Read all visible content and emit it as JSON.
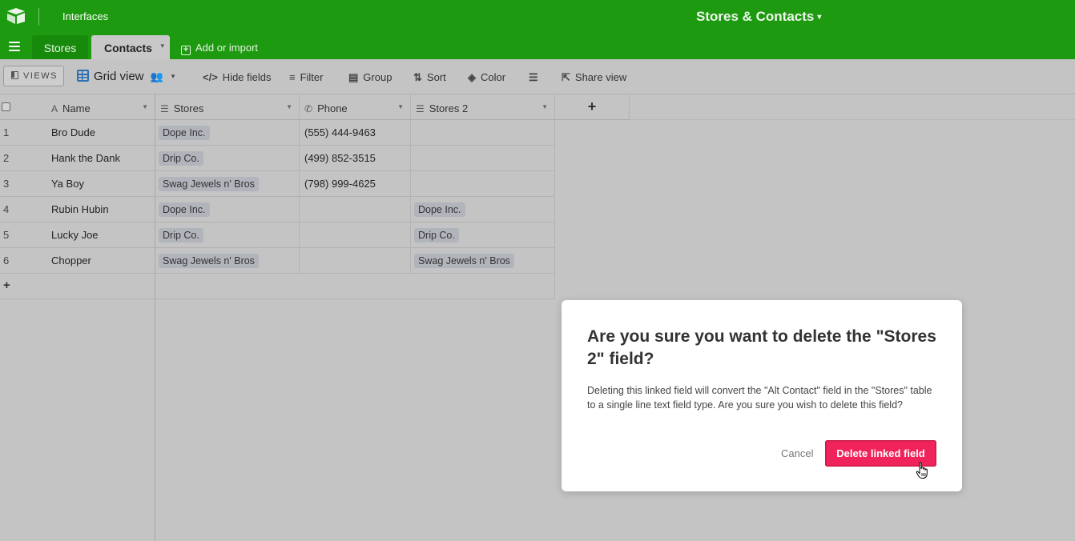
{
  "topbar": {
    "logo_icon": "airtable-logo-icon",
    "interfaces_label": "Interfaces",
    "base_title": "Stores & Contacts",
    "base_caret": "▾",
    "bg_color": "#1d9a0f"
  },
  "tabs": {
    "menu_icon": "hamburger-icon",
    "items": [
      {
        "label": "Stores",
        "active": false
      },
      {
        "label": "Contacts",
        "active": true
      }
    ],
    "active_caret": "▾",
    "add_import_label": "Add or import"
  },
  "toolbar": {
    "views_label": "VIEWS",
    "view_name": "Grid view",
    "view_people_icon": "👥",
    "view_caret": "▾",
    "hide_fields_label": "Hide fields",
    "filter_label": "Filter",
    "group_label": "Group",
    "sort_label": "Sort",
    "color_label": "Color",
    "row_height_icon": "row-height-icon",
    "share_view_label": "Share view"
  },
  "grid": {
    "columns": [
      {
        "name": "Name",
        "icon": "A",
        "icon_name": "text-field-icon"
      },
      {
        "name": "Stores",
        "icon": "☰",
        "icon_name": "linked-record-icon"
      },
      {
        "name": "Phone",
        "icon": "✆",
        "icon_name": "phone-icon"
      },
      {
        "name": "Stores 2",
        "icon": "☰",
        "icon_name": "linked-record-icon"
      }
    ],
    "add_column_label": "+",
    "add_row_label": "+",
    "rows": [
      {
        "num": "1",
        "name": "Bro Dude",
        "stores": "Dope Inc.",
        "phone": "(555) 444-9463",
        "stores2": ""
      },
      {
        "num": "2",
        "name": "Hank the Dank",
        "stores": "Drip Co.",
        "phone": "(499) 852-3515",
        "stores2": ""
      },
      {
        "num": "3",
        "name": "Ya Boy",
        "stores": "Swag Jewels n' Bros",
        "phone": "(798) 999-4625",
        "stores2": ""
      },
      {
        "num": "4",
        "name": "Rubin Hubin",
        "stores": "Dope Inc.",
        "phone": "",
        "stores2": "Dope Inc."
      },
      {
        "num": "5",
        "name": "Lucky Joe",
        "stores": "Drip Co.",
        "phone": "",
        "stores2": "Drip Co."
      },
      {
        "num": "6",
        "name": "Chopper",
        "stores": "Swag Jewels n' Bros",
        "phone": "",
        "stores2": "Swag Jewels n' Bros"
      }
    ]
  },
  "modal": {
    "title": "Are you sure you want to delete the \"Stores 2\" field?",
    "body": "Deleting this linked field will convert the \"Alt Contact\" field in the \"Stores\" table to a single line text field type. Are you sure you wish to delete this field?",
    "cancel_label": "Cancel",
    "confirm_label": "Delete linked field",
    "confirm_color": "#f0245a"
  }
}
